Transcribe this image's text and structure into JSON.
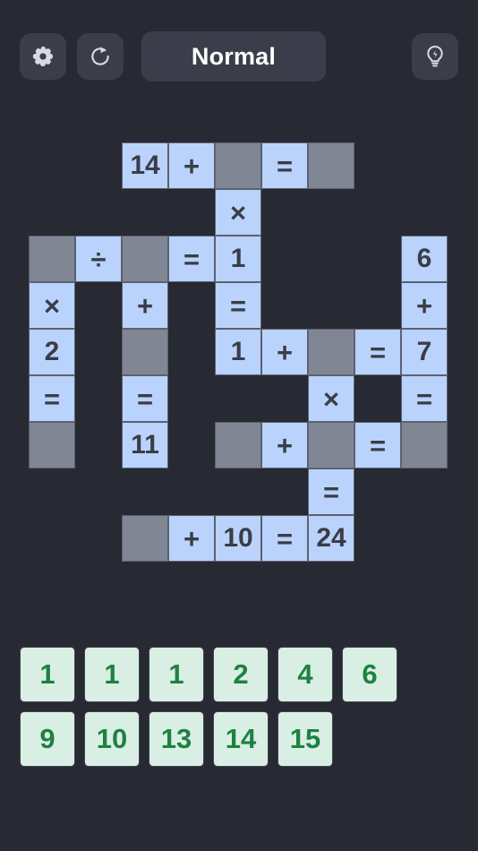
{
  "header": {
    "settings_icon": "gear-icon",
    "restart_icon": "refresh-icon",
    "mode_label": "Normal",
    "hint_icon": "lightbulb-icon"
  },
  "grid": {
    "columns": 9,
    "rows": 9,
    "cell_size": 52,
    "colors": {
      "filled": "#bad3fd",
      "blank": "#808693",
      "text": "#3a3d47",
      "background": "#282a33"
    },
    "cells": [
      {
        "r": 0,
        "c": 2,
        "t": "14",
        "k": "filled"
      },
      {
        "r": 0,
        "c": 3,
        "t": "+",
        "k": "op"
      },
      {
        "r": 0,
        "c": 4,
        "t": "",
        "k": "blank"
      },
      {
        "r": 0,
        "c": 5,
        "t": "=",
        "k": "op"
      },
      {
        "r": 0,
        "c": 6,
        "t": "",
        "k": "blank"
      },
      {
        "r": 1,
        "c": 4,
        "t": "×",
        "k": "op"
      },
      {
        "r": 2,
        "c": 0,
        "t": "",
        "k": "blank"
      },
      {
        "r": 2,
        "c": 1,
        "t": "÷",
        "k": "op"
      },
      {
        "r": 2,
        "c": 2,
        "t": "",
        "k": "blank"
      },
      {
        "r": 2,
        "c": 3,
        "t": "=",
        "k": "op"
      },
      {
        "r": 2,
        "c": 4,
        "t": "1",
        "k": "filled"
      },
      {
        "r": 2,
        "c": 8,
        "t": "6",
        "k": "filled"
      },
      {
        "r": 3,
        "c": 0,
        "t": "×",
        "k": "op"
      },
      {
        "r": 3,
        "c": 2,
        "t": "+",
        "k": "op"
      },
      {
        "r": 3,
        "c": 4,
        "t": "=",
        "k": "op"
      },
      {
        "r": 3,
        "c": 8,
        "t": "+",
        "k": "op"
      },
      {
        "r": 4,
        "c": 0,
        "t": "2",
        "k": "filled"
      },
      {
        "r": 4,
        "c": 2,
        "t": "",
        "k": "blank"
      },
      {
        "r": 4,
        "c": 4,
        "t": "1",
        "k": "filled"
      },
      {
        "r": 4,
        "c": 5,
        "t": "+",
        "k": "op"
      },
      {
        "r": 4,
        "c": 6,
        "t": "",
        "k": "blank"
      },
      {
        "r": 4,
        "c": 7,
        "t": "=",
        "k": "op"
      },
      {
        "r": 4,
        "c": 8,
        "t": "7",
        "k": "filled"
      },
      {
        "r": 5,
        "c": 0,
        "t": "=",
        "k": "op"
      },
      {
        "r": 5,
        "c": 2,
        "t": "=",
        "k": "op"
      },
      {
        "r": 5,
        "c": 6,
        "t": "×",
        "k": "op"
      },
      {
        "r": 5,
        "c": 8,
        "t": "=",
        "k": "op"
      },
      {
        "r": 6,
        "c": 0,
        "t": "",
        "k": "blank"
      },
      {
        "r": 6,
        "c": 2,
        "t": "11",
        "k": "filled"
      },
      {
        "r": 6,
        "c": 4,
        "t": "",
        "k": "blank"
      },
      {
        "r": 6,
        "c": 5,
        "t": "+",
        "k": "op"
      },
      {
        "r": 6,
        "c": 6,
        "t": "",
        "k": "blank"
      },
      {
        "r": 6,
        "c": 7,
        "t": "=",
        "k": "op"
      },
      {
        "r": 6,
        "c": 8,
        "t": "",
        "k": "blank"
      },
      {
        "r": 7,
        "c": 6,
        "t": "=",
        "k": "op"
      },
      {
        "r": 8,
        "c": 2,
        "t": "",
        "k": "blank"
      },
      {
        "r": 8,
        "c": 3,
        "t": "+",
        "k": "op"
      },
      {
        "r": 8,
        "c": 4,
        "t": "10",
        "k": "filled"
      },
      {
        "r": 8,
        "c": 5,
        "t": "=",
        "k": "op"
      },
      {
        "r": 8,
        "c": 6,
        "t": "24",
        "k": "filled"
      }
    ]
  },
  "tray": {
    "tile_color": "#daefe4",
    "tile_text_color": "#1e8142",
    "tiles": [
      "1",
      "1",
      "1",
      "2",
      "4",
      "6",
      "9",
      "10",
      "13",
      "14",
      "15"
    ]
  }
}
